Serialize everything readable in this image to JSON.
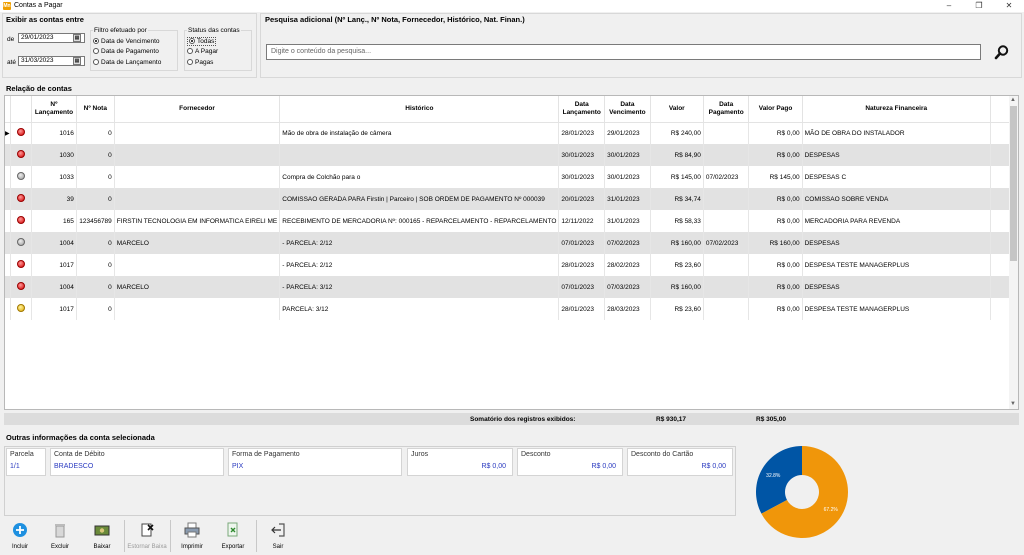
{
  "window": {
    "title": "Contas a Pagar",
    "icon_text": "Mn"
  },
  "filters": {
    "title": "Exibir as contas entre",
    "de_label": "de",
    "ate_label": "até",
    "date_from": "29/01/2023",
    "date_to": "31/03/2023",
    "filter_by": {
      "title": "Filtro efetuado por",
      "options": [
        "Data de Vencimento",
        "Data de Pagamento",
        "Data de Lançamento"
      ],
      "selected": 0
    },
    "status": {
      "title": "Status das contas",
      "options": [
        "Todas",
        "A Pagar",
        "Pagas"
      ],
      "selected": 0
    }
  },
  "search": {
    "title": "Pesquisa adicional (Nº Lanç., Nº Nota, Fornecedor, Histórico, Nat. Finan.)",
    "placeholder": "Digite o conteúdo da pesquisa...",
    "icon": "search-icon"
  },
  "table": {
    "title": "Relação de contas",
    "columns": [
      "",
      "Nº\nLançamento",
      "Nº Nota",
      "Fornecedor",
      "Histórico",
      "Data\nLançamento",
      "Data\nVencimento",
      "Valor",
      "Data\nPagamento",
      "Valor Pago",
      "Natureza Financeira"
    ],
    "rows": [
      {
        "status": "red",
        "lanc": "1016",
        "nota": "0",
        "forn": "",
        "hist": "Mão de obra de instalação de câmera",
        "dlanc": "28/01/2023",
        "dvenc": "29/01/2023",
        "valor": "R$ 240,00",
        "dpag": "",
        "vpago": "R$ 0,00",
        "nat": "MÃO DE OBRA DO INSTALADOR"
      },
      {
        "status": "red",
        "lanc": "1030",
        "nota": "0",
        "forn": "",
        "hist": "",
        "dlanc": "30/01/2023",
        "dvenc": "30/01/2023",
        "valor": "R$ 84,90",
        "dpag": "",
        "vpago": "R$ 0,00",
        "nat": "DESPESAS"
      },
      {
        "status": "gray",
        "lanc": "1033",
        "nota": "0",
        "forn": "",
        "hist": "Compra de Colchão para o",
        "dlanc": "30/01/2023",
        "dvenc": "30/01/2023",
        "valor": "R$ 145,00",
        "dpag": "07/02/2023",
        "vpago": "R$ 145,00",
        "nat": "DESPESAS C"
      },
      {
        "status": "red",
        "lanc": "39",
        "nota": "0",
        "forn": "",
        "hist": "COMISSAO GERADA PARA Firstin | Parceiro | SOB ORDEM DE PAGAMENTO Nº 000039",
        "dlanc": "20/01/2023",
        "dvenc": "31/01/2023",
        "valor": "R$ 34,74",
        "dpag": "",
        "vpago": "R$ 0,00",
        "nat": "COMISSAO SOBRE VENDA"
      },
      {
        "status": "red",
        "lanc": "165",
        "nota": "123456789",
        "forn": "FIRSTIN TECNOLOGIA EM INFORMATICA EIRELI ME",
        "hist": "RECEBIMENTO DE MERCADORIA Nº: 000165 - REPARCELAMENTO - REPARCELAMENTO",
        "dlanc": "12/11/2022",
        "dvenc": "31/01/2023",
        "valor": "R$ 58,33",
        "dpag": "",
        "vpago": "R$ 0,00",
        "nat": "MERCADORIA PARA REVENDA"
      },
      {
        "status": "gray",
        "lanc": "1004",
        "nota": "0",
        "forn": "MARCELO",
        "hist": "- PARCELA: 2/12",
        "dlanc": "07/01/2023",
        "dvenc": "07/02/2023",
        "valor": "R$ 160,00",
        "dpag": "07/02/2023",
        "vpago": "R$ 160,00",
        "nat": "DESPESAS"
      },
      {
        "status": "red",
        "lanc": "1017",
        "nota": "0",
        "forn": "",
        "hist": "- PARCELA: 2/12",
        "dlanc": "28/01/2023",
        "dvenc": "28/02/2023",
        "valor": "R$ 23,60",
        "dpag": "",
        "vpago": "R$ 0,00",
        "nat": "DESPESA TESTE MANAGERPLUS"
      },
      {
        "status": "red",
        "lanc": "1004",
        "nota": "0",
        "forn": "MARCELO",
        "hist": "- PARCELA: 3/12",
        "dlanc": "07/01/2023",
        "dvenc": "07/03/2023",
        "valor": "R$ 160,00",
        "dpag": "",
        "vpago": "R$ 0,00",
        "nat": "DESPESAS"
      },
      {
        "status": "yellow",
        "lanc": "1017",
        "nota": "0",
        "forn": "",
        "hist": "PARCELA: 3/12",
        "dlanc": "28/01/2023",
        "dvenc": "28/03/2023",
        "valor": "R$ 23,60",
        "dpag": "",
        "vpago": "R$ 0,00",
        "nat": "DESPESA TESTE MANAGERPLUS"
      }
    ],
    "sum_label": "Somatório dos registros exibidos:",
    "sum_valor": "R$ 930,17",
    "sum_pago": "R$ 305,00"
  },
  "info": {
    "title": "Outras informações da conta selecionada",
    "parcela_label": "Parcela",
    "parcela": "1/1",
    "conta_label": "Conta de Débito",
    "conta": "BRADESCO",
    "forma_label": "Forma de Pagamento",
    "forma": "PIX",
    "juros_label": "Juros",
    "juros": "R$ 0,00",
    "desconto_label": "Desconto",
    "desconto": "R$ 0,00",
    "desc_cartao_label": "Desconto do Cartão",
    "desc_cartao": "R$ 0,00"
  },
  "pie": {
    "slices": [
      {
        "label": "32.8%",
        "value": 32.8,
        "color": "#0055a5"
      },
      {
        "label": "67.2%",
        "value": 67.2,
        "color": "#f0960a"
      }
    ]
  },
  "toolbar": {
    "incluir": "Incluir",
    "excluir": "Excluir",
    "baixar": "Baixar",
    "estornar": "Estornar Baixa",
    "imprimir": "Imprimir",
    "exportar": "Exportar",
    "sair": "Sair"
  }
}
